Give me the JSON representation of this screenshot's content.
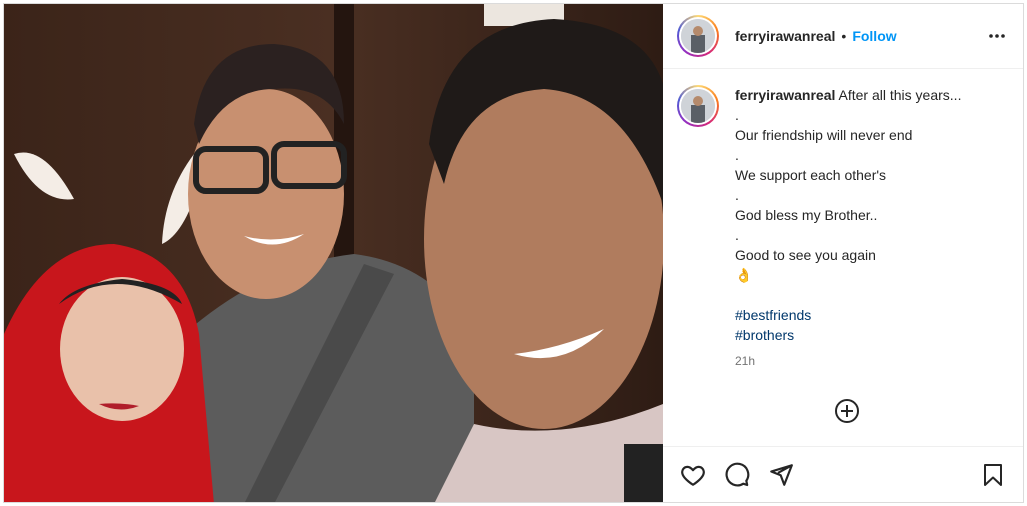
{
  "post": {
    "username": "ferryirawanreal",
    "separator": "•",
    "follow_label": "Follow",
    "caption": {
      "lines": [
        "After all this years...",
        ".",
        "Our friendship will never end",
        ".",
        "We support each other's",
        ".",
        "God bless my Brother..",
        ".",
        "Good to see you again",
        "👌"
      ],
      "hashtags": [
        "#bestfriends",
        "#brothers"
      ],
      "time": "21h"
    }
  },
  "icons": {
    "more": "more-options-icon",
    "add_comment": "add-comment-icon",
    "like": "heart-icon",
    "comment": "comment-icon",
    "share": "share-icon",
    "save": "bookmark-icon"
  }
}
